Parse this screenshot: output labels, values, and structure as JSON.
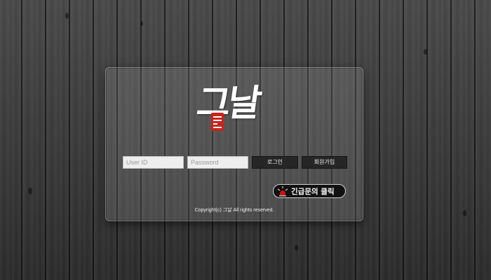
{
  "logo": {
    "text": "그날",
    "seal_text": "那天"
  },
  "login": {
    "user_id_placeholder": "User ID",
    "password_placeholder": "Password",
    "login_label": "로그인",
    "signup_label": "회원가입"
  },
  "emergency": {
    "label": "긴급문의 클릭",
    "icon": "siren-icon"
  },
  "footer": {
    "copyright": "Copyright(c) 그날 All rights reserved."
  },
  "colors": {
    "seal": "#c8231c",
    "button": "#262626",
    "siren": "#d01010"
  }
}
